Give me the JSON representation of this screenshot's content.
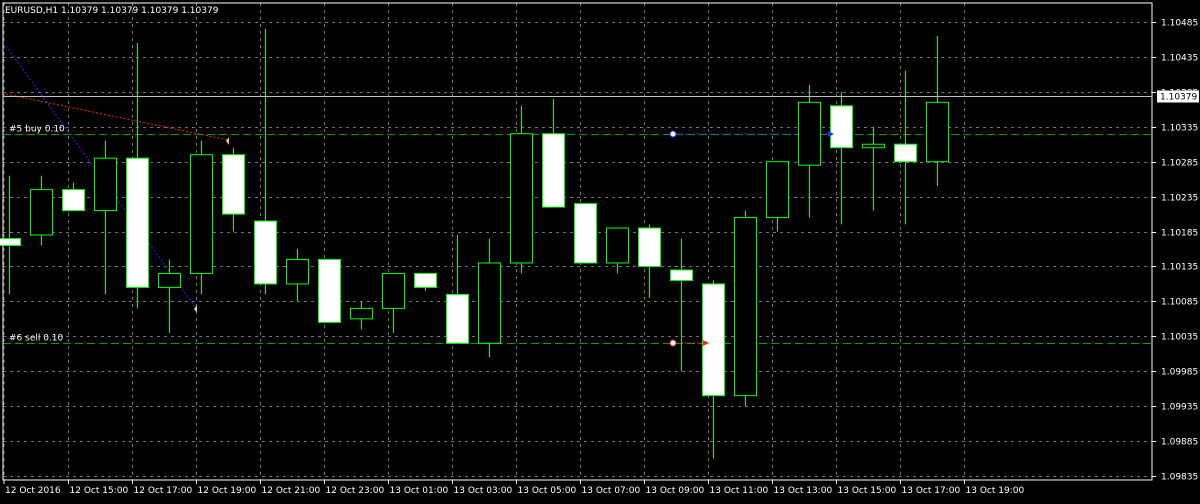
{
  "window": {
    "header": "EURUSD,H1  1.10379 1.10379 1.10379 1.10379",
    "current_price": "1.10379"
  },
  "colors": {
    "background": "#000000",
    "candle_outline": "#00ff00",
    "bull_fill": "#000000",
    "bear_fill": "#ffffff",
    "grid": "#c0c0c0",
    "text": "#ffffff",
    "order_line": "#00a000",
    "buy_arrow": "#2030ff",
    "sell_arrow": "#ff2020",
    "bid_line": "#c0c0c0"
  },
  "orders": [
    {
      "label": "#5 buy 0.10",
      "price": 1.10325
    },
    {
      "label": "#6 sell 0.10",
      "price": 1.10025
    }
  ],
  "chart_data": {
    "type": "candlestick",
    "symbol": "EURUSD",
    "timeframe": "H1",
    "ylim": [
      1.09835,
      1.10535
    ],
    "grid": true,
    "y_ticks": [
      "1.10485",
      "1.10435",
      "1.10385",
      "1.10335",
      "1.10285",
      "1.10235",
      "1.10185",
      "1.10135",
      "1.10085",
      "1.10035",
      "1.09985",
      "1.09935",
      "1.09885",
      "1.09835"
    ],
    "x_ticks": [
      "12 Oct 2016",
      "12 Oct 15:00",
      "12 Oct 17:00",
      "12 Oct 19:00",
      "12 Oct 21:00",
      "12 Oct 23:00",
      "13 Oct 01:00",
      "13 Oct 03:00",
      "13 Oct 05:00",
      "13 Oct 07:00",
      "13 Oct 09:00",
      "13 Oct 11:00",
      "13 Oct 13:00",
      "13 Oct 15:00",
      "13 Oct 17:00",
      "13 Oct 19:00"
    ],
    "candles": [
      {
        "t": "12 Oct 2016 13:00",
        "o": 1.10175,
        "h": 1.10265,
        "l": 1.10095,
        "c": 1.10165
      },
      {
        "t": "12 Oct 14:00",
        "o": 1.1018,
        "h": 1.10265,
        "l": 1.10165,
        "c": 1.10245
      },
      {
        "t": "12 Oct 15:00",
        "o": 1.10245,
        "h": 1.10255,
        "l": 1.10215,
        "c": 1.10215
      },
      {
        "t": "12 Oct 16:00",
        "o": 1.10215,
        "h": 1.10315,
        "l": 1.10095,
        "c": 1.1029
      },
      {
        "t": "12 Oct 17:00",
        "o": 1.1029,
        "h": 1.10455,
        "l": 1.10075,
        "c": 1.10105
      },
      {
        "t": "12 Oct 18:00",
        "o": 1.10105,
        "h": 1.10145,
        "l": 1.1004,
        "c": 1.10125
      },
      {
        "t": "12 Oct 19:00",
        "o": 1.10125,
        "h": 1.10315,
        "l": 1.10095,
        "c": 1.10295
      },
      {
        "t": "12 Oct 20:00",
        "o": 1.10295,
        "h": 1.10305,
        "l": 1.10185,
        "c": 1.1021
      },
      {
        "t": "12 Oct 21:00",
        "o": 1.102,
        "h": 1.10475,
        "l": 1.10095,
        "c": 1.1011
      },
      {
        "t": "12 Oct 22:00",
        "o": 1.1011,
        "h": 1.1016,
        "l": 1.10085,
        "c": 1.10145
      },
      {
        "t": "12 Oct 23:00",
        "o": 1.10145,
        "h": 1.10145,
        "l": 1.10055,
        "c": 1.10055
      },
      {
        "t": "13 Oct 00:00",
        "o": 1.1006,
        "h": 1.10085,
        "l": 1.10045,
        "c": 1.10075
      },
      {
        "t": "13 Oct 01:00",
        "o": 1.10075,
        "h": 1.10125,
        "l": 1.1004,
        "c": 1.10125
      },
      {
        "t": "13 Oct 02:00",
        "o": 1.10125,
        "h": 1.10125,
        "l": 1.101,
        "c": 1.10105
      },
      {
        "t": "13 Oct 03:00",
        "o": 1.10095,
        "h": 1.1018,
        "l": 1.10025,
        "c": 1.10025
      },
      {
        "t": "13 Oct 04:00",
        "o": 1.10025,
        "h": 1.10175,
        "l": 1.10005,
        "c": 1.1014
      },
      {
        "t": "13 Oct 05:00",
        "o": 1.1014,
        "h": 1.10365,
        "l": 1.10125,
        "c": 1.10325
      },
      {
        "t": "13 Oct 06:00",
        "o": 1.10325,
        "h": 1.10375,
        "l": 1.1022,
        "c": 1.1022
      },
      {
        "t": "13 Oct 07:00",
        "o": 1.10225,
        "h": 1.10225,
        "l": 1.1014,
        "c": 1.1014
      },
      {
        "t": "13 Oct 08:00",
        "o": 1.1014,
        "h": 1.1019,
        "l": 1.10125,
        "c": 1.1019
      },
      {
        "t": "13 Oct 09:00",
        "o": 1.1019,
        "h": 1.10195,
        "l": 1.1009,
        "c": 1.10135
      },
      {
        "t": "13 Oct 10:00",
        "o": 1.1013,
        "h": 1.10175,
        "l": 1.09985,
        "c": 1.10115
      },
      {
        "t": "13 Oct 11:00",
        "o": 1.1011,
        "h": 1.10115,
        "l": 1.0986,
        "c": 1.0995
      },
      {
        "t": "13 Oct 12:00",
        "o": 1.0995,
        "h": 1.10215,
        "l": 1.09935,
        "c": 1.10205
      },
      {
        "t": "13 Oct 13:00",
        "o": 1.10205,
        "h": 1.10285,
        "l": 1.10185,
        "c": 1.10285
      },
      {
        "t": "13 Oct 14:00",
        "o": 1.1028,
        "h": 1.10395,
        "l": 1.10205,
        "c": 1.1037
      },
      {
        "t": "13 Oct 15:00",
        "o": 1.10365,
        "h": 1.10385,
        "l": 1.10195,
        "c": 1.10305
      },
      {
        "t": "13 Oct 16:00",
        "o": 1.10305,
        "h": 1.10335,
        "l": 1.10215,
        "c": 1.1031
      },
      {
        "t": "13 Oct 17:00",
        "o": 1.1031,
        "h": 1.10415,
        "l": 1.10195,
        "c": 1.10285
      },
      {
        "t": "13 Oct 18:00",
        "o": 1.10285,
        "h": 1.10465,
        "l": 1.1025,
        "c": 1.1037
      }
    ]
  }
}
